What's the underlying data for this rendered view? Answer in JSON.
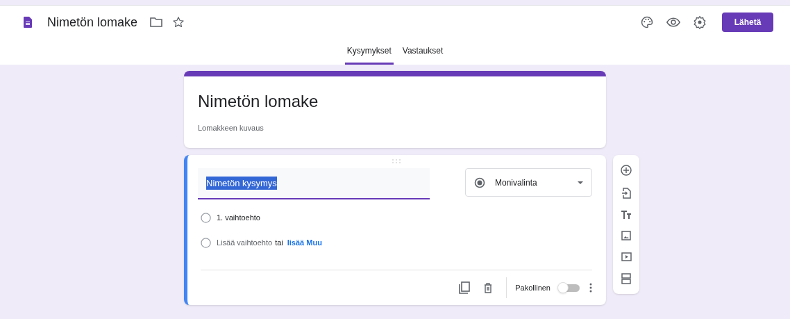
{
  "header": {
    "title": "Nimetön lomake",
    "starred": false,
    "send_button": "Lähetä"
  },
  "tabs": [
    {
      "label": "Kysymykset",
      "selected": true
    },
    {
      "label": "Vastaukset",
      "selected": false
    }
  ],
  "form": {
    "title": "Nimetön lomake",
    "description": "Lomakkeen kuvaus"
  },
  "question": {
    "title": "Nimetön kysymys",
    "title_selected": true,
    "type": "Monivalinta",
    "options": [
      {
        "kind": "option",
        "label": "1. vaihtoehto"
      },
      {
        "kind": "add",
        "label": "Lisää vaihtoehto",
        "separator": "tai",
        "link": "lisää Muu"
      }
    ],
    "required": {
      "label": "Pakollinen",
      "on": false
    }
  }
}
